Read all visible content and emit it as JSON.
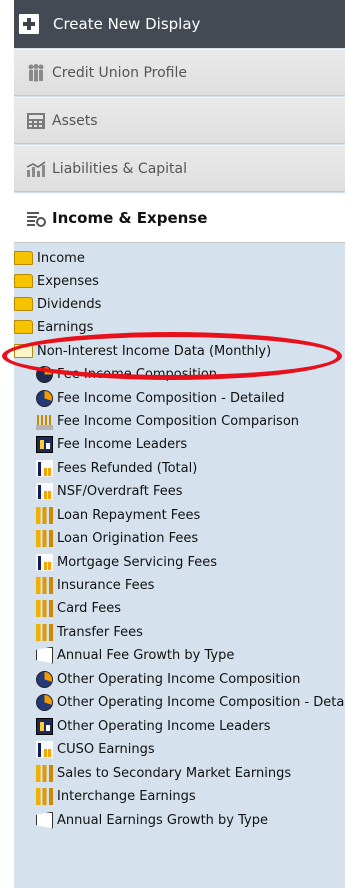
{
  "header": {
    "create_label": "Create New Display"
  },
  "sections": [
    {
      "label": "Credit Union Profile",
      "icon": "people-icon"
    },
    {
      "label": "Assets",
      "icon": "calculator-icon"
    },
    {
      "label": "Liabilities & Capital",
      "icon": "bar-chart-icon"
    },
    {
      "label": "Income & Expense",
      "icon": "list-icon",
      "active": true
    }
  ],
  "tree": {
    "folders": [
      {
        "label": "Income",
        "state": "closed"
      },
      {
        "label": "Expenses",
        "state": "closed"
      },
      {
        "label": "Dividends",
        "state": "closed"
      },
      {
        "label": "Earnings",
        "state": "closed"
      },
      {
        "label": "Non-Interest Income Data (Monthly)",
        "state": "open"
      }
    ],
    "items": [
      {
        "label": "Fee Income Composition",
        "icon": "pie-chart-icon"
      },
      {
        "label": "Fee Income Composition - Detailed",
        "icon": "pie-chart-icon"
      },
      {
        "label": "Fee Income Composition Comparison",
        "icon": "comparison-chart-icon"
      },
      {
        "label": "Fee Income Leaders",
        "icon": "leaders-icon"
      },
      {
        "label": "Fees Refunded (Total)",
        "icon": "bar-chart-icon"
      },
      {
        "label": "NSF/Overdraft Fees",
        "icon": "bar-chart-icon"
      },
      {
        "label": "Loan Repayment Fees",
        "icon": "bar-chart-icon"
      },
      {
        "label": "Loan Origination Fees",
        "icon": "bar-chart-icon"
      },
      {
        "label": "Mortgage Servicing Fees",
        "icon": "bar-chart-icon"
      },
      {
        "label": "Insurance Fees",
        "icon": "bar-chart-icon"
      },
      {
        "label": "Card Fees",
        "icon": "bar-chart-icon"
      },
      {
        "label": "Transfer Fees",
        "icon": "bar-chart-icon"
      },
      {
        "label": "Annual Fee Growth by Type",
        "icon": "growth-chart-icon"
      },
      {
        "label": "Other Operating Income Composition",
        "icon": "pie-chart-icon"
      },
      {
        "label": "Other Operating Income Composition - Detailed",
        "icon": "pie-chart-icon"
      },
      {
        "label": "Other Operating Income Leaders",
        "icon": "leaders-icon"
      },
      {
        "label": "CUSO Earnings",
        "icon": "bar-chart-icon"
      },
      {
        "label": "Sales to Secondary Market Earnings",
        "icon": "bar-chart-icon"
      },
      {
        "label": "Interchange Earnings",
        "icon": "bar-chart-icon"
      },
      {
        "label": "Annual Earnings Growth by Type",
        "icon": "growth-chart-icon"
      }
    ]
  },
  "annotation": {
    "color": "#e8101a"
  }
}
